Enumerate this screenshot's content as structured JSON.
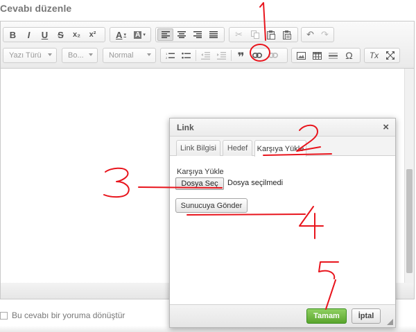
{
  "page": {
    "title": "Cevabı düzenle"
  },
  "toolbar": {
    "combos": [
      {
        "label": "Yazı Türü"
      },
      {
        "label": "Bo..."
      },
      {
        "label": "Normal"
      }
    ],
    "icons": {
      "bold": "B",
      "italic": "I",
      "underline": "U",
      "strike": "S",
      "subscript": "x₂",
      "superscript": "x²",
      "font_color": "A",
      "bg_color": "A",
      "blockquote": "❞",
      "special_char": "Ω",
      "clear_format": "Tx"
    }
  },
  "editor": {
    "accent": "#5aa52d"
  },
  "dialog": {
    "title": "Link",
    "close": "×",
    "tabs": [
      "Link Bilgisi",
      "Hedef",
      "Karşıya Yükle"
    ],
    "active_tab": 2,
    "upload_label": "Karşıya Yükle",
    "file_button": "Dosya Seç",
    "file_status": "Dosya seçilmedi",
    "send_button": "Sunucuya Gönder",
    "ok_button": "Tamam",
    "cancel_button": "İptal"
  },
  "below": {
    "checkbox_label": "Bu cevabı bir yoruma dönüştür"
  },
  "annotations": {
    "color": "#e8141c",
    "numbers": [
      "1",
      "2",
      "3",
      "4",
      "5"
    ]
  }
}
